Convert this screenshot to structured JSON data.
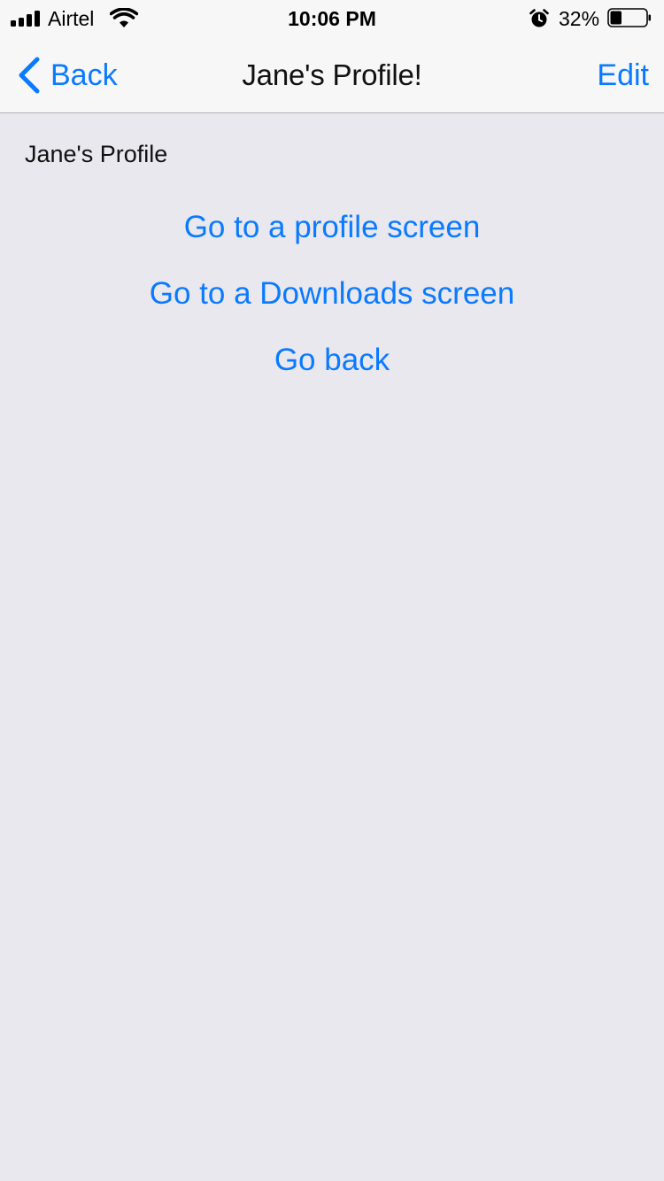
{
  "status_bar": {
    "carrier": "Airtel",
    "time": "10:06 PM",
    "battery_percent": "32%",
    "battery_level": 0.32,
    "icons": [
      "signal-icon",
      "wifi-icon",
      "alarm-icon",
      "battery-icon"
    ]
  },
  "nav": {
    "back_label": "Back",
    "title": "Jane's Profile!",
    "edit_label": "Edit"
  },
  "content": {
    "label": "Jane's Profile",
    "links": [
      "Go to a profile screen",
      "Go to a Downloads screen",
      "Go back"
    ]
  },
  "colors": {
    "accent": "#0a7aff",
    "background": "#e9e8ee",
    "bar_background": "#f7f7f7",
    "separator": "#b2b2b2"
  }
}
